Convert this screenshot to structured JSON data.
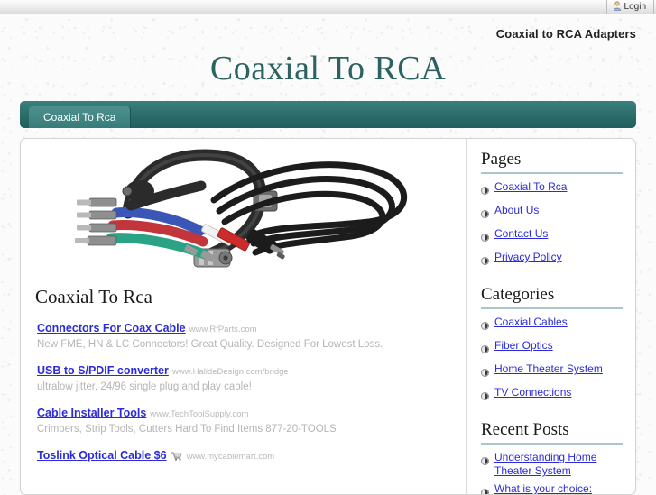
{
  "topbar": {
    "login_label": "Login",
    "user_icon": "user-icon"
  },
  "header": {
    "tagline": "Coaxial to RCA Adapters",
    "site_title": "Coaxial To RCA"
  },
  "nav": {
    "tabs": [
      {
        "label": "Coaxial To Rca",
        "active": true
      }
    ]
  },
  "main": {
    "image_alt": "component-video-and-rca-cables-photo",
    "post_title": "Coaxial To Rca",
    "ads": [
      {
        "link": "Connectors For Coax Cable",
        "url": "www.RfParts.com",
        "desc": "New FME, HN & LC Connectors! Great Quality. Designed For Lowest Loss.",
        "cart": false
      },
      {
        "link": "USB to S/PDIF converter",
        "url": "www.HalideDesign.com/bridge",
        "desc": "ultralow jitter, 24/96 single plug and play cable!",
        "cart": false
      },
      {
        "link": "Cable Installer Tools",
        "url": "www.TechToolSupply.com",
        "desc": "Crimpers, Strip Tools, Cutters Hard To Find Items 877-20-TOOLS",
        "cart": false
      },
      {
        "link": "Toslink Optical Cable $6",
        "url": "www.mycablemart.com",
        "desc": "",
        "cart": true
      }
    ]
  },
  "sidebar": {
    "blocks": [
      {
        "heading": "Pages",
        "items": [
          {
            "label": "Coaxial To Rca"
          },
          {
            "label": "About Us"
          },
          {
            "label": "Contact Us"
          },
          {
            "label": "Privacy Policy"
          }
        ]
      },
      {
        "heading": "Categories",
        "items": [
          {
            "label": "Coaxial Cables"
          },
          {
            "label": "Fiber Optics"
          },
          {
            "label": "Home Theater System"
          },
          {
            "label": "TV Connections"
          }
        ]
      },
      {
        "heading": "Recent Posts",
        "items": [
          {
            "label": "Understanding Home Theater System"
          },
          {
            "label": "What is your choice:"
          }
        ]
      }
    ]
  },
  "colors": {
    "teal_nav": "#2d6f6c",
    "teal_tab": "#3f8582",
    "title_teal": "#2c6360",
    "link_blue": "#2b2bdb",
    "ad_gray": "#b5b5b5",
    "rule_teal": "#a9c8c5"
  }
}
